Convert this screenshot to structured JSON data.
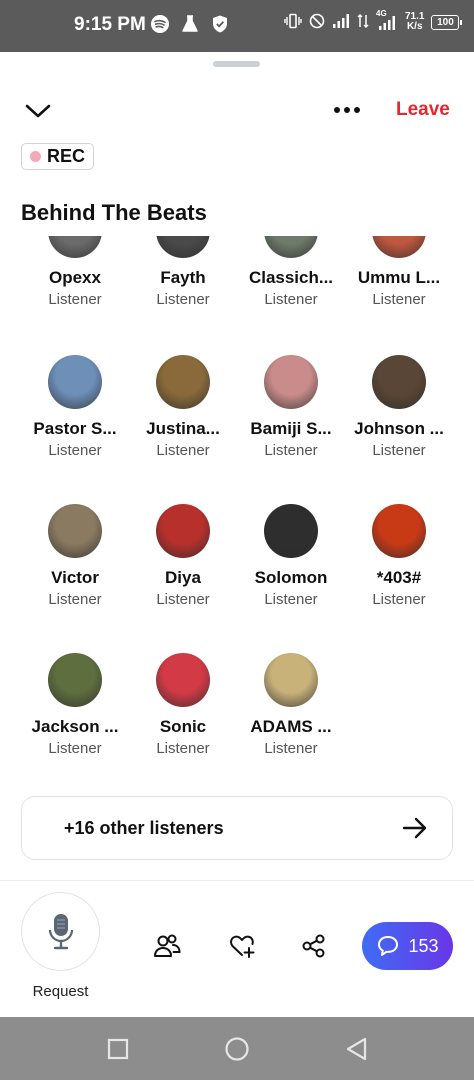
{
  "status_bar": {
    "time": "9:15 PM",
    "network_type": "4G",
    "speed_value": "71.1",
    "speed_unit": "K/s",
    "battery": "100",
    "app_icons": [
      "spotify-icon",
      "flask-icon",
      "shield-icon"
    ],
    "system_icons": [
      "vibrate-icon",
      "do-not-disturb-icon",
      "signal-icon",
      "data-transfer-icon",
      "signal-4g-icon"
    ]
  },
  "header": {
    "leave_label": "Leave",
    "leave_color": "#e8262e",
    "rec_label": "REC"
  },
  "space": {
    "title": "Behind The Beats"
  },
  "participants": [
    {
      "name": "Opexx",
      "role": "Listener",
      "avatar_color": "#6b6b6b"
    },
    {
      "name": "Fayth",
      "role": "Listener",
      "avatar_color": "#4a4a4a"
    },
    {
      "name": "Classich...",
      "role": "Listener",
      "avatar_color": "#6f7b6a"
    },
    {
      "name": "Ummu L...",
      "role": "Listener",
      "avatar_color": "#c0573f"
    },
    {
      "name": "Pastor S...",
      "role": "Listener",
      "avatar_color": "#6d8fb8"
    },
    {
      "name": "Justina...",
      "role": "Listener",
      "avatar_color": "#8a6a3a"
    },
    {
      "name": "Bamiji S...",
      "role": "Listener",
      "avatar_color": "#c98c8a"
    },
    {
      "name": "Johnson ...",
      "role": "Listener",
      "avatar_color": "#5a4636"
    },
    {
      "name": "Victor",
      "role": "Listener",
      "avatar_color": "#8a7a62"
    },
    {
      "name": "Diya",
      "role": "Listener",
      "avatar_color": "#b8302c"
    },
    {
      "name": "Solomon",
      "role": "Listener",
      "avatar_color": "#2e2e2e"
    },
    {
      "name": "*403#",
      "role": "Listener",
      "avatar_color": "#c83a16"
    },
    {
      "name": "Jackson ...",
      "role": "Listener",
      "avatar_color": "#5e6e3e"
    },
    {
      "name": "Sonic",
      "role": "Listener",
      "avatar_color": "#d23a45"
    },
    {
      "name": "ADAMS ...",
      "role": "Listener",
      "avatar_color": "#c9b27a"
    }
  ],
  "other_listeners": {
    "label": "+16 other listeners"
  },
  "bottom_bar": {
    "request_label": "Request",
    "comment_count": "153",
    "accent_color": "#4f55ef"
  }
}
